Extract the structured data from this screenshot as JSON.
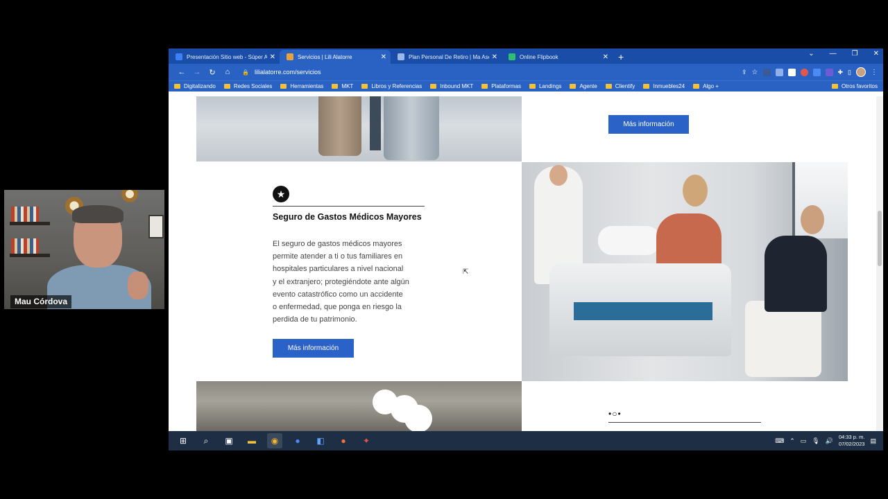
{
  "webcam": {
    "name": "Mau Córdova"
  },
  "browser": {
    "tabs": [
      {
        "title": "Presentación Sitio web - Súper A",
        "icon_color": "#3b82f6",
        "active": false
      },
      {
        "title": "Servicios | Lili Alatorre",
        "icon_color": "#e9a23b",
        "active": true
      },
      {
        "title": "Plan Personal De Retiro | Ma Ase",
        "icon_color": "#9bb8e8",
        "active": false
      },
      {
        "title": "Online Flipbook",
        "icon_color": "#2fbf71",
        "active": false
      }
    ],
    "new_tab": "+",
    "url": "lilialatorre.com/servicios",
    "bookmarks": [
      "Digitalizando",
      "Redes Sociales",
      "Herramientas",
      "MKT",
      "Libros y Referencias",
      "Inbound MKT",
      "Plataformas",
      "Landings",
      "Agente",
      "Clientify",
      "Inmuebles24",
      "Algo +"
    ],
    "other_bookmarks": "Otros favoritos"
  },
  "page": {
    "top_button": "Más información",
    "card": {
      "icon": "star-icon",
      "title": "Seguro de Gastos Médicos Mayores",
      "body_lines": [
        "El seguro de gastos médicos mayores",
        "permite atender a ti o tus familiares en",
        "hospitales particulares a nivel nacional",
        "y el extranjero; protegiéndote ante algún",
        "evento catastrófico como un accidente",
        "o enfermedad, que ponga en riesgo la",
        "perdida de tu patrimonio."
      ],
      "button": "Más información"
    },
    "next_card_icon": "•○•"
  },
  "taskbar": {
    "time": "04:33 p. m.",
    "date": "07/02/2023"
  },
  "colors": {
    "chrome_blue": "#2a62c4",
    "button_blue": "#2b62c7"
  }
}
